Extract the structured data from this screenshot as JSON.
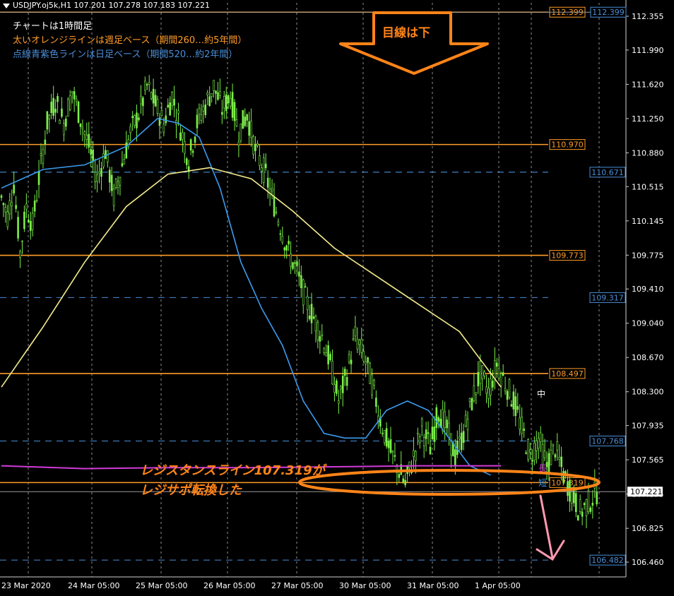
{
  "header": {
    "title": "USDJPY.oj5k,H1  107.201 107.278 107.183 107.221"
  },
  "notes": {
    "line1": "チャートは1時間足",
    "line2": "太いオレンジラインは週足ベース（期間260…約5年間）",
    "line3": "点線青紫色ラインは日足ベース（期間520…約2年間）"
  },
  "annotations": {
    "big_arrow": "目線は下",
    "resistance_1": "レジスタンスライン107.319が",
    "resistance_2": "レジサポ転換した",
    "mid_label": "中",
    "long_label": "長",
    "short_label": "短"
  },
  "colors": {
    "background": "#000000",
    "candle": "#7cf04a",
    "orange_level": "#ff9c27",
    "blue_level": "#4a8ed8",
    "ma_short": "#3a9cf0",
    "ma_mid": "#f5ec8c",
    "ma_long": "#d23ad8",
    "annotation": "#ff8418",
    "pink_arrow": "#ff9ab0"
  },
  "chart_data": {
    "type": "line",
    "title": "USDJPY.oj5k,H1",
    "price_axis": {
      "ticks": [
        "112.355",
        "111.990",
        "111.620",
        "111.250",
        "110.880",
        "110.515",
        "110.145",
        "109.775",
        "109.410",
        "109.040",
        "108.670",
        "108.300",
        "107.935",
        "107.565",
        "107.195",
        "106.825",
        "106.460"
      ],
      "range": [
        106.3,
        112.5
      ],
      "current_price": "107.221"
    },
    "time_axis": {
      "labels": [
        "23 Mar 2020",
        "24 Mar 05:00",
        "25 Mar 05:00",
        "26 Mar 05:00",
        "27 Mar 05:00",
        "30 Mar 05:00",
        "31 Mar 05:00",
        "1 Apr 05:00"
      ]
    },
    "horizontal_levels": [
      {
        "value": 112.399,
        "label": "112.399",
        "style": "orange",
        "kind": "weekly"
      },
      {
        "value": 110.97,
        "label": "110.970",
        "style": "orange",
        "kind": "weekly"
      },
      {
        "value": 110.671,
        "label": "110.671",
        "style": "blue-dash",
        "kind": "daily"
      },
      {
        "value": 109.773,
        "label": "109.773",
        "style": "orange",
        "kind": "weekly"
      },
      {
        "value": 109.317,
        "label": "109.317",
        "style": "blue-dash",
        "kind": "daily"
      },
      {
        "value": 108.497,
        "label": "108.497",
        "style": "orange",
        "kind": "weekly"
      },
      {
        "value": 107.768,
        "label": "107.768",
        "style": "blue-dash",
        "kind": "daily"
      },
      {
        "value": 107.319,
        "label": "107.319",
        "style": "orange",
        "kind": "weekly"
      },
      {
        "value": 106.482,
        "label": "106.482",
        "style": "blue-dash",
        "kind": "daily"
      }
    ],
    "price_path": [
      [
        0,
        110.4
      ],
      [
        3,
        110.2
      ],
      [
        6,
        110.55
      ],
      [
        9,
        109.8
      ],
      [
        12,
        110.3
      ],
      [
        15,
        110.1
      ],
      [
        18,
        110.6
      ],
      [
        22,
        111.2
      ],
      [
        26,
        111.45
      ],
      [
        30,
        111.2
      ],
      [
        34,
        111.55
      ],
      [
        38,
        111.25
      ],
      [
        42,
        110.95
      ],
      [
        46,
        110.6
      ],
      [
        50,
        110.9
      ],
      [
        54,
        110.4
      ],
      [
        58,
        110.75
      ],
      [
        62,
        111.1
      ],
      [
        66,
        111.3
      ],
      [
        70,
        111.6
      ],
      [
        74,
        111.4
      ],
      [
        78,
        111.2
      ],
      [
        82,
        111.5
      ],
      [
        86,
        111.15
      ],
      [
        90,
        110.8
      ],
      [
        94,
        111.2
      ],
      [
        98,
        111.4
      ],
      [
        102,
        111.6
      ],
      [
        106,
        111.35
      ],
      [
        110,
        111.5
      ],
      [
        114,
        111.1
      ],
      [
        118,
        111.3
      ],
      [
        122,
        110.9
      ],
      [
        126,
        110.7
      ],
      [
        130,
        110.4
      ],
      [
        134,
        110.1
      ],
      [
        138,
        109.8
      ],
      [
        142,
        109.6
      ],
      [
        146,
        109.3
      ],
      [
        150,
        109.1
      ],
      [
        154,
        108.9
      ],
      [
        158,
        108.6
      ],
      [
        162,
        108.2
      ],
      [
        166,
        108.5
      ],
      [
        170,
        108.9
      ],
      [
        174,
        108.7
      ],
      [
        178,
        108.4
      ],
      [
        182,
        108.0
      ],
      [
        186,
        107.7
      ],
      [
        190,
        107.5
      ],
      [
        194,
        107.3
      ],
      [
        198,
        107.6
      ],
      [
        202,
        107.9
      ],
      [
        206,
        107.7
      ],
      [
        210,
        108.1
      ],
      [
        214,
        107.9
      ],
      [
        218,
        107.6
      ],
      [
        222,
        107.85
      ],
      [
        226,
        108.2
      ],
      [
        230,
        108.5
      ],
      [
        234,
        108.3
      ],
      [
        238,
        108.6
      ],
      [
        242,
        108.4
      ],
      [
        246,
        108.2
      ],
      [
        250,
        107.9
      ],
      [
        254,
        107.6
      ],
      [
        258,
        107.8
      ],
      [
        262,
        107.5
      ],
      [
        266,
        107.7
      ],
      [
        270,
        107.4
      ],
      [
        274,
        107.2
      ],
      [
        278,
        107.0
      ],
      [
        282,
        107.1
      ],
      [
        286,
        107.22
      ]
    ],
    "series": [
      {
        "color": "#3a9cf0",
        "values": [
          [
            0,
            110.5
          ],
          [
            20,
            110.7
          ],
          [
            40,
            110.75
          ],
          [
            60,
            110.95
          ],
          [
            75,
            111.25
          ],
          [
            85,
            111.2
          ],
          [
            95,
            111.05
          ],
          [
            105,
            110.5
          ],
          [
            115,
            109.7
          ],
          [
            125,
            109.2
          ],
          [
            135,
            108.8
          ],
          [
            145,
            108.2
          ],
          [
            155,
            107.85
          ],
          [
            165,
            107.8
          ],
          [
            175,
            107.8
          ],
          [
            185,
            108.1
          ],
          [
            195,
            108.2
          ],
          [
            205,
            108.1
          ],
          [
            215,
            107.8
          ],
          [
            225,
            107.5
          ],
          [
            235,
            107.4
          ]
        ]
      },
      {
        "color": "#f5ec8c",
        "values": [
          [
            0,
            108.35
          ],
          [
            20,
            109.0
          ],
          [
            40,
            109.7
          ],
          [
            60,
            110.3
          ],
          [
            80,
            110.65
          ],
          [
            100,
            110.72
          ],
          [
            120,
            110.6
          ],
          [
            140,
            110.25
          ],
          [
            160,
            109.85
          ],
          [
            180,
            109.55
          ],
          [
            200,
            109.25
          ],
          [
            220,
            108.95
          ],
          [
            240,
            108.35
          ]
        ]
      },
      {
        "color": "#d23ad8",
        "values": [
          [
            0,
            107.5
          ],
          [
            40,
            107.47
          ],
          [
            80,
            107.48
          ],
          [
            120,
            107.48
          ],
          [
            160,
            107.49
          ],
          [
            200,
            107.5
          ],
          [
            240,
            107.5
          ]
        ]
      }
    ]
  }
}
